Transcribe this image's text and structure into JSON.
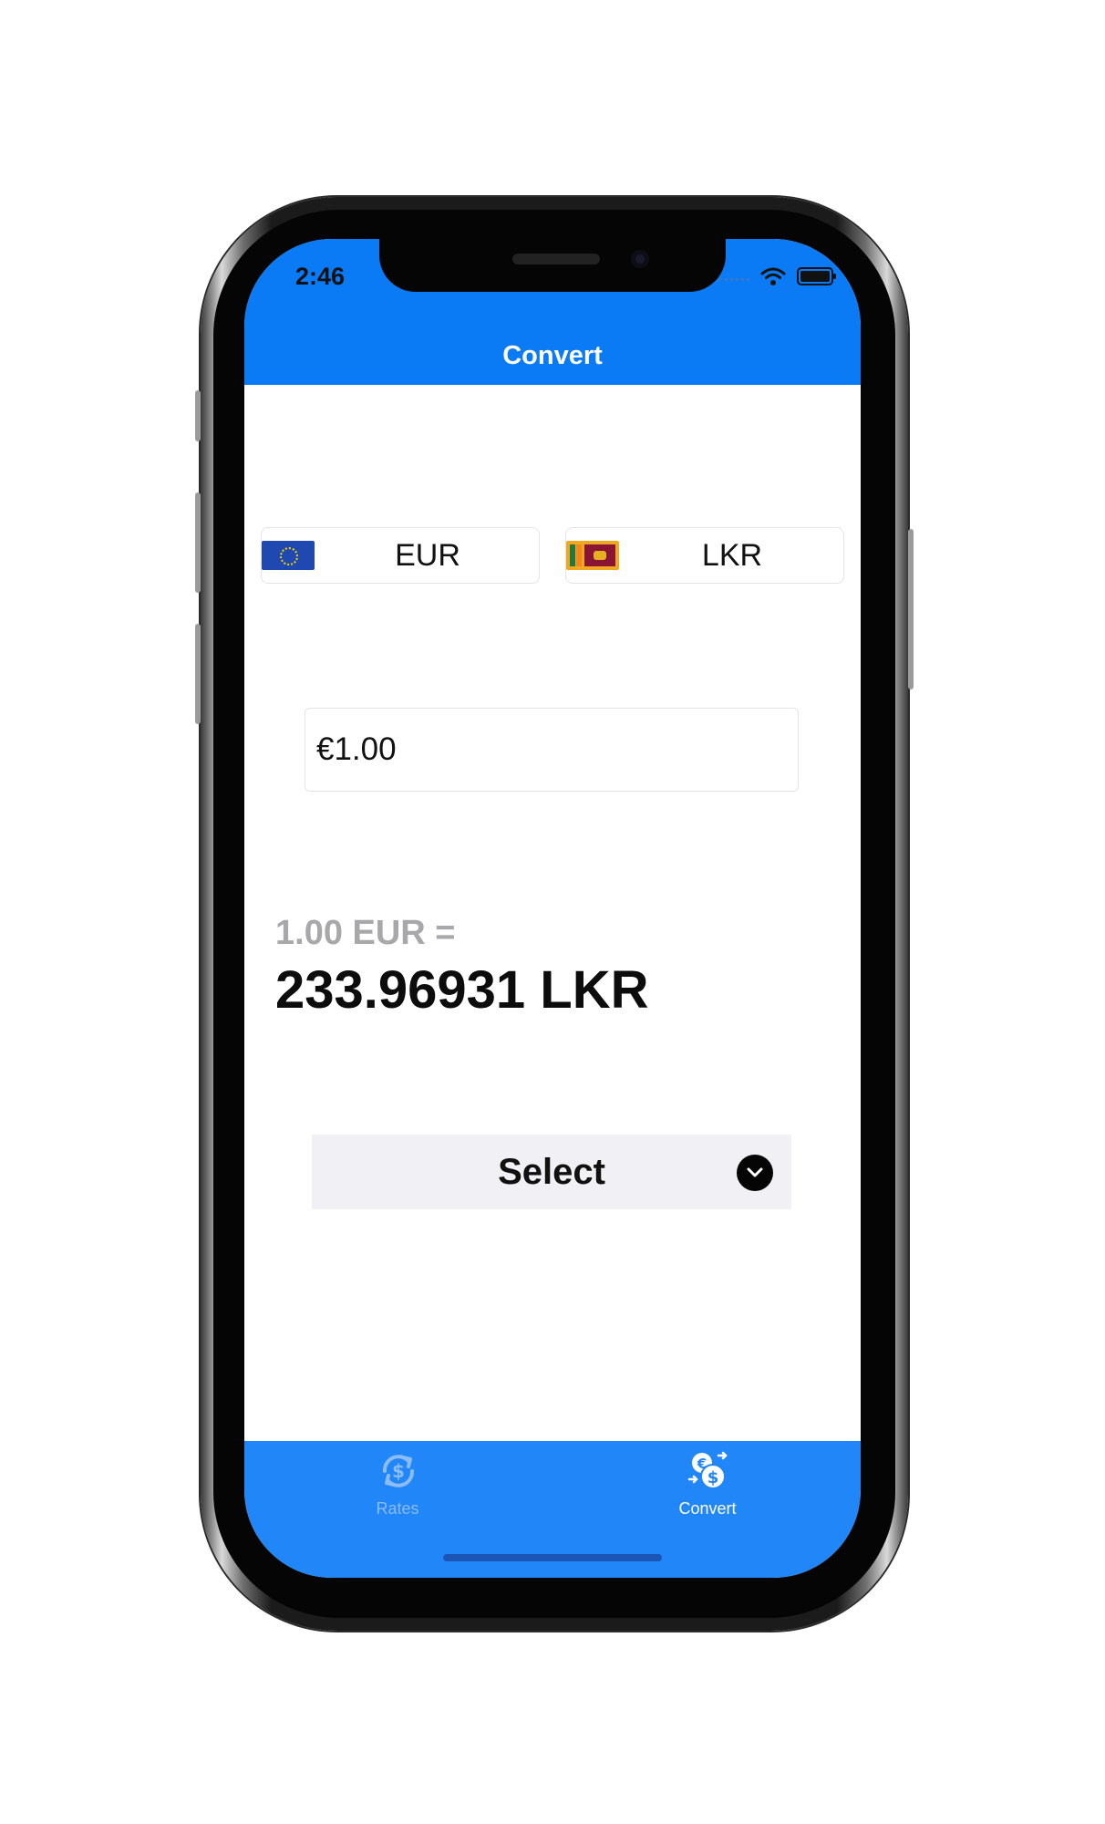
{
  "status_bar": {
    "time": "2:46"
  },
  "nav": {
    "title": "Convert"
  },
  "currencies": {
    "from": {
      "code": "EUR",
      "flag_icon": "eu-flag-icon"
    },
    "to": {
      "code": "LKR",
      "flag_icon": "sri-lanka-flag-icon"
    }
  },
  "amount_input": {
    "value": "€1.00"
  },
  "result": {
    "from_text": "1.00 EUR =",
    "to_text": "233.96931 LKR"
  },
  "select": {
    "label": "Select",
    "icon": "chevron-down-circle-icon"
  },
  "tab_bar": {
    "tabs": [
      {
        "label": "Rates",
        "icon": "rates-refresh-dollar-icon",
        "active": false
      },
      {
        "label": "Convert",
        "icon": "currency-exchange-icon",
        "active": true
      }
    ]
  },
  "colors": {
    "primary": "#0a7bf5",
    "tab_bar": "#2186f7",
    "muted_text": "#a8a8aa",
    "tab_inactive": "#8cbcf5"
  }
}
